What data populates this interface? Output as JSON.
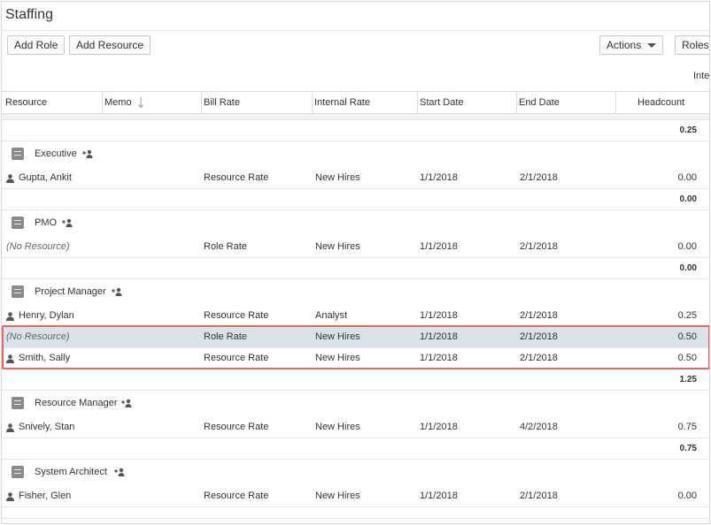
{
  "page": {
    "title": "Staffing"
  },
  "toolbar": {
    "add_role": "Add Role",
    "add_resource": "Add Resource",
    "actions": "Actions",
    "roles": "Roles F",
    "clipped_label": "Inter"
  },
  "columns": {
    "resource": "Resource",
    "memo": "Memo",
    "bill_rate": "Bill Rate",
    "internal_rate": "Internal Rate",
    "start_date": "Start Date",
    "end_date": "End Date",
    "headcount": "Headcount"
  },
  "grand_total": "0.25",
  "groups": [
    {
      "name": "Executive",
      "rows": [
        {
          "resource": "Gupta, Ankit",
          "bill_rate": "Resource Rate",
          "internal_rate": "New Hires",
          "start_date": "1/1/2018",
          "end_date": "2/1/2018",
          "headcount": "0.00"
        }
      ],
      "total": "0.00"
    },
    {
      "name": "PMO",
      "rows": [
        {
          "resource": "(No Resource)",
          "bill_rate": "Role Rate",
          "internal_rate": "New Hires",
          "start_date": "1/1/2018",
          "end_date": "2/1/2018",
          "headcount": "0.00"
        }
      ],
      "total": "0.00"
    },
    {
      "name": "Project Manager",
      "rows": [
        {
          "resource": "Henry, Dylan",
          "bill_rate": "Resource Rate",
          "internal_rate": "Analyst",
          "start_date": "1/1/2018",
          "end_date": "2/1/2018",
          "headcount": "0.25"
        },
        {
          "resource": "(No Resource)",
          "bill_rate": "Role Rate",
          "internal_rate": "New Hires",
          "start_date": "1/1/2018",
          "end_date": "2/1/2018",
          "headcount": "0.50"
        },
        {
          "resource": "Smith, Sally",
          "bill_rate": "Resource Rate",
          "internal_rate": "New Hires",
          "start_date": "1/1/2018",
          "end_date": "2/1/2018",
          "headcount": "0.50"
        }
      ],
      "total": "1.25"
    },
    {
      "name": "Resource Manager",
      "rows": [
        {
          "resource": "Snively, Stan",
          "bill_rate": "Resource Rate",
          "internal_rate": "New Hires",
          "start_date": "1/1/2018",
          "end_date": "4/2/2018",
          "headcount": "0.75"
        }
      ],
      "total": "0.75"
    },
    {
      "name": "System Architect",
      "rows": [
        {
          "resource": "Fisher, Glen",
          "bill_rate": "Resource Rate",
          "internal_rate": "New Hires",
          "start_date": "1/1/2018",
          "end_date": "2/1/2018",
          "headcount": "0.00"
        }
      ]
    }
  ],
  "colors": {
    "highlight": "#e8675a",
    "selected_row": "#d9e2e9"
  }
}
